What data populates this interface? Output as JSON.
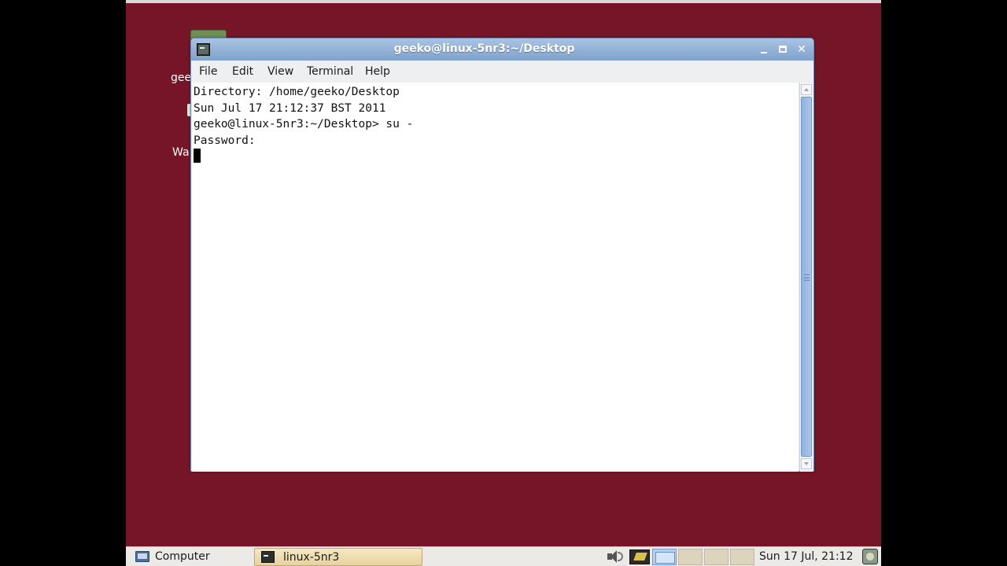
{
  "desktop": {
    "icon_labels": [
      "gee",
      "Wa"
    ]
  },
  "terminal_window": {
    "title": "geeko@linux-5nr3:~/Desktop",
    "menu": [
      "File",
      "Edit",
      "View",
      "Terminal",
      "Help"
    ],
    "lines": [
      "Directory: /home/geeko/Desktop",
      "Sun Jul 17 21:12:37 BST 2011",
      "geeko@linux-5nr3:~/Desktop> su -",
      "Password:"
    ]
  },
  "taskbar": {
    "computer_label": "Computer",
    "task_label": "linux-5nr3",
    "clock": "Sun 17 Jul, 21:12",
    "workspaces": 4,
    "active_workspace": 1
  },
  "colors": {
    "desktop_background": "#761528",
    "titlebar": "#8fb0d8",
    "taskbar": "#eceae6"
  },
  "icons": [
    "computer-icon",
    "terminal-icon",
    "volume-icon",
    "notes-icon",
    "screensaver-icon",
    "minimize-icon",
    "maximize-icon",
    "close-icon"
  ]
}
